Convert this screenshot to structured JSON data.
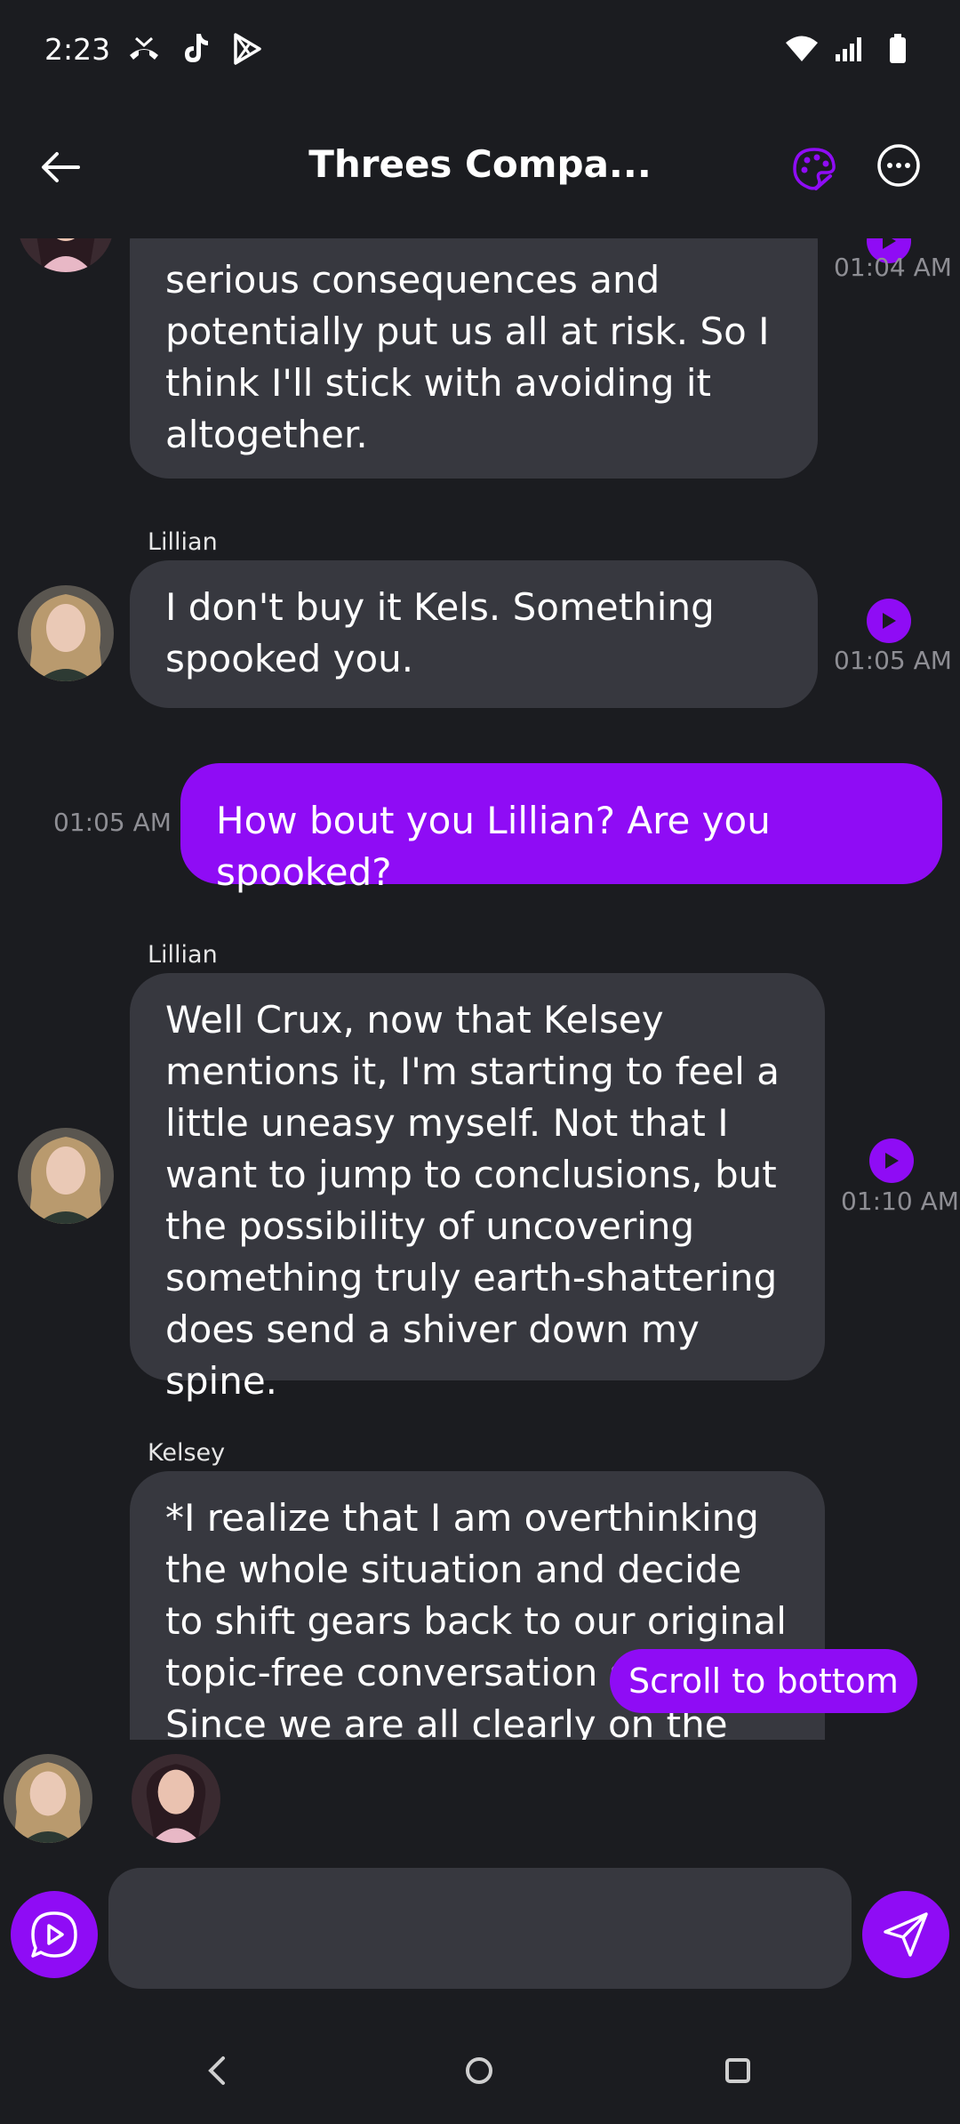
{
  "status_bar": {
    "time": "2:23",
    "icons": [
      "missed-call-icon",
      "tiktok-icon",
      "play-store-icon"
    ],
    "right_icons": [
      "wifi-icon",
      "signal-icon",
      "battery-icon"
    ]
  },
  "header": {
    "title": "Threes Compa...",
    "accent": "#8f0cf5"
  },
  "messages": [
    {
      "sender": "",
      "text": "serious consequences and potentially put us all at risk. So I think I'll stick with avoiding it altogether.",
      "time": "01:04 AM",
      "mine": false
    },
    {
      "sender": "Lillian",
      "text": "I don't buy it Kels. Something spooked you.",
      "time": "01:05 AM",
      "mine": false
    },
    {
      "sender": "",
      "text": "How bout you Lillian? Are you spooked?",
      "time": "01:05 AM",
      "mine": true
    },
    {
      "sender": "Lillian",
      "text": "Well Crux, now that Kelsey mentions it, I'm starting to feel a little uneasy myself. Not that I want to jump to conclusions, but the possibility of uncovering something truly earth-shattering does send a shiver down my spine.",
      "time": "01:10 AM",
      "mine": false
    },
    {
      "sender": "Kelsey",
      "text": "*I realize that I am overthinking the whole situation and decide to shift gears back to our original topic-free conversation style* Since we are all clearly on the same page",
      "time": "",
      "mine": false
    }
  ],
  "scroll_to_bottom": "Scroll to bottom",
  "composer": {
    "placeholder": "",
    "value": ""
  }
}
